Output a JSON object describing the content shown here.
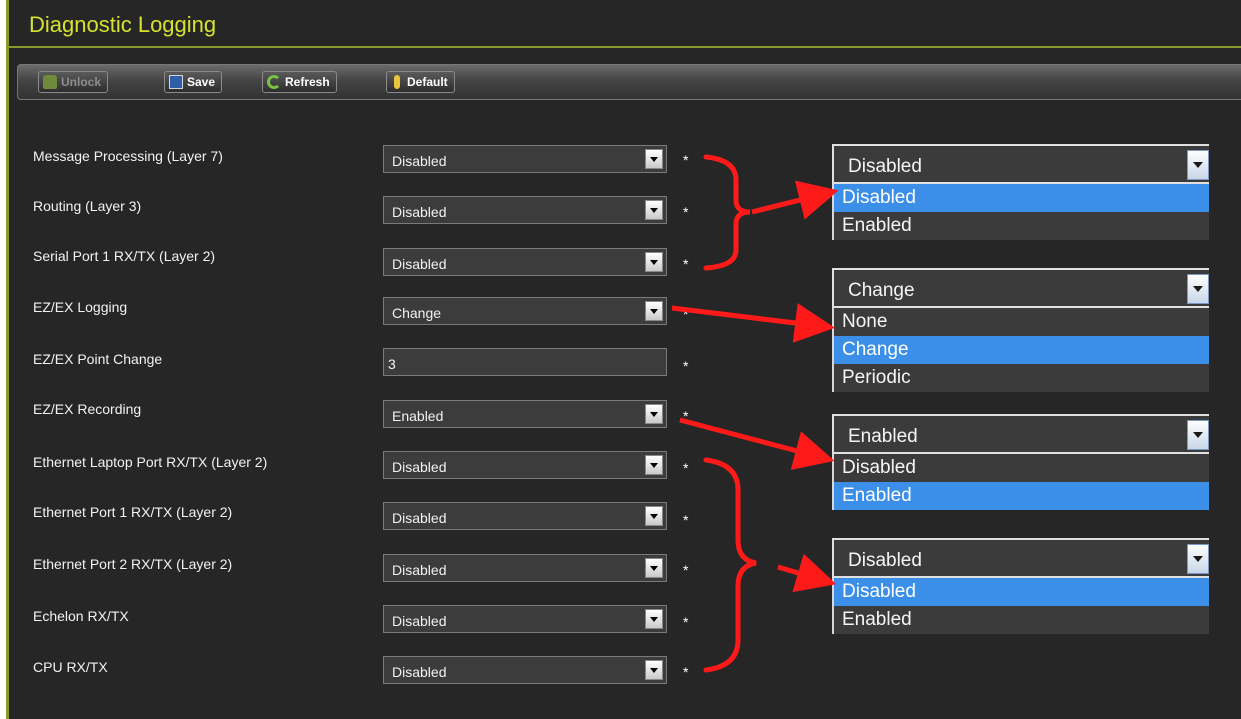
{
  "title": "Diagnostic Logging",
  "toolbar": {
    "unlock": "Unlock",
    "save": "Save",
    "refresh": "Refresh",
    "default": "Default"
  },
  "rows": [
    {
      "label": "Message Processing (Layer 7)",
      "value": "Disabled",
      "type": "select"
    },
    {
      "label": "Routing (Layer 3)",
      "value": "Disabled",
      "type": "select"
    },
    {
      "label": "Serial Port 1 RX/TX (Layer 2)",
      "value": "Disabled",
      "type": "select"
    },
    {
      "label": "EZ/EX Logging",
      "value": "Change",
      "type": "select"
    },
    {
      "label": "EZ/EX Point Change",
      "value": "3",
      "type": "text"
    },
    {
      "label": "EZ/EX Recording",
      "value": "Enabled",
      "type": "select"
    },
    {
      "label": "Ethernet Laptop Port RX/TX (Layer 2)",
      "value": "Disabled",
      "type": "select"
    },
    {
      "label": "Ethernet Port 1 RX/TX (Layer 2)",
      "value": "Disabled",
      "type": "select"
    },
    {
      "label": "Ethernet Port 2 RX/TX (Layer 2)",
      "value": "Disabled",
      "type": "select"
    },
    {
      "label": "Echelon RX/TX",
      "value": "Disabled",
      "type": "select"
    },
    {
      "label": "CPU RX/TX",
      "value": "Disabled",
      "type": "select"
    }
  ],
  "required_marker": "*",
  "popups": [
    {
      "selected": "Disabled",
      "options": [
        "Disabled",
        "Enabled"
      ],
      "highlighted": "Disabled"
    },
    {
      "selected": "Change",
      "options": [
        "None",
        "Change",
        "Periodic"
      ],
      "highlighted": "Change"
    },
    {
      "selected": "Enabled",
      "options": [
        "Disabled",
        "Enabled"
      ],
      "highlighted": "Enabled"
    },
    {
      "selected": "Disabled",
      "options": [
        "Disabled",
        "Enabled"
      ],
      "highlighted": "Disabled"
    }
  ],
  "colors": {
    "accent": "#d7e22f",
    "highlight": "#3c8fe8",
    "annotation": "#ff0000",
    "background": "#262626"
  }
}
